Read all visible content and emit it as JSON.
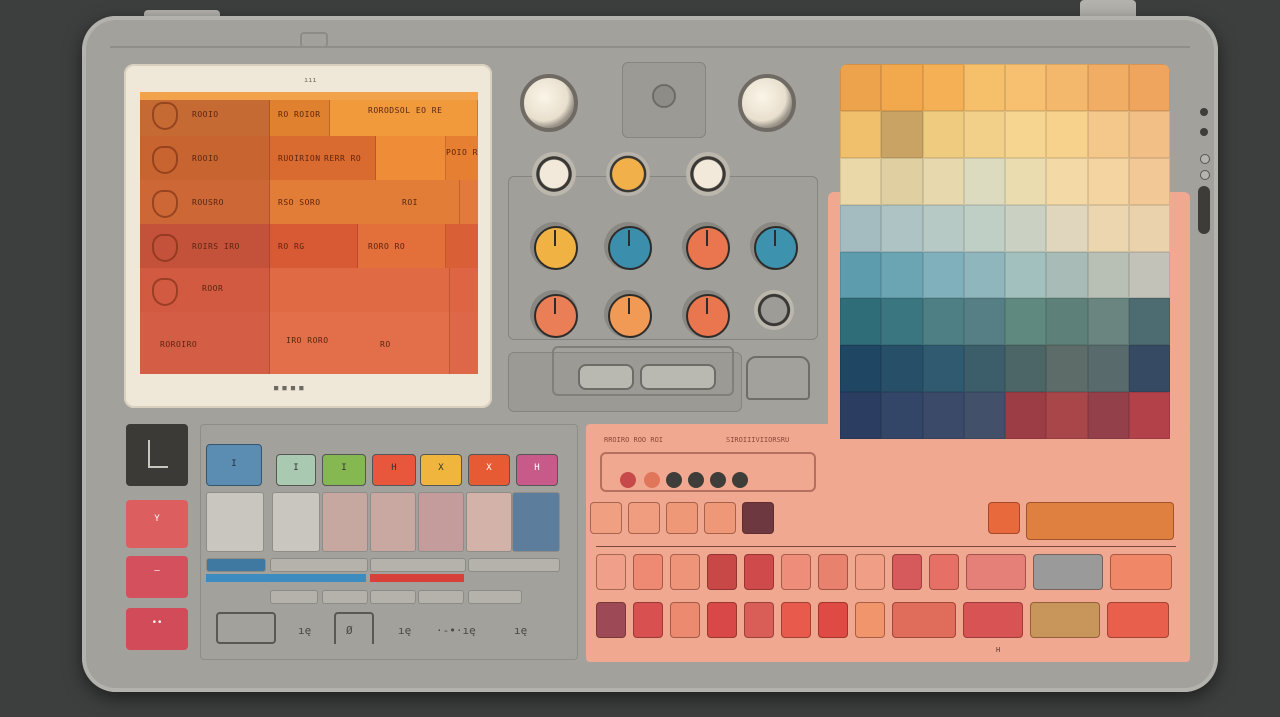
{
  "device": {
    "screen": {
      "top_caption": "ııı",
      "bottom_caption": "■ ■ ■ ■",
      "rows": [
        {
          "name": "ROOIO",
          "field1": "RO ROIOR",
          "field2": "RORODSOL EO RE"
        },
        {
          "name": "ROOIO",
          "field1": "RUOIRION",
          "field2": "RERR RO",
          "field3": "POIO RIOO"
        },
        {
          "name": "ROUSRO",
          "field1": "RSO SORO",
          "field2": "ROI"
        },
        {
          "name": "ROIRS IRO",
          "field1": "RO RG",
          "field2": "RORO RO"
        },
        {
          "name": "ROOR"
        },
        {
          "name": "ROROIRO",
          "field1": "IRO RORO",
          "field2": "RO"
        }
      ]
    },
    "pink_panel": {
      "label_left": "RROIRO ROO  ROI",
      "label_right": "SIROIIIVIIORSRU",
      "footer": "H"
    },
    "left_keys": [
      {
        "label": "Y"
      },
      {
        "label": "—"
      },
      {
        "label": "••"
      }
    ],
    "top_pads": [
      "I",
      "I",
      "I",
      "H",
      "X",
      "H"
    ],
    "bottom_marks": [
      "ıę",
      "Ø",
      "ıę",
      "·-•·ıę",
      "ıę"
    ]
  },
  "colors": {
    "body": "#a2a19b",
    "screen_orange": "#e1703a",
    "accent_pink": "#f0a890",
    "swatches": [
      [
        "#eda24c",
        "#f2a94d",
        "#f5af55",
        "#f6bf6a",
        "#f6c070",
        "#f4b86c",
        "#f2ad64",
        "#f0a55f"
      ],
      [
        "#f0c06c",
        "#c9a364",
        "#efcb80",
        "#f3d08a",
        "#f5d590",
        "#f6d28d",
        "#f4c88a",
        "#f2c086"
      ],
      [
        "#ead8a8",
        "#dfcfa1",
        "#e7d9ad",
        "#dcdbc0",
        "#ebdcb0",
        "#f3d9a6",
        "#f4d4a0",
        "#f1c896"
      ],
      [
        "#a4bcc0",
        "#aec3c3",
        "#b6c9c4",
        "#bfcfc5",
        "#cad1c2",
        "#e0d6bd",
        "#ebd6b0",
        "#ead2ad"
      ],
      [
        "#5c9cac",
        "#6ba5b3",
        "#80b0bc",
        "#8fb6bc",
        "#a2c0bd",
        "#a8bbb6",
        "#b8c0b6",
        "#c2c2b8"
      ],
      [
        "#2f6d79",
        "#3a7680",
        "#4e7f84",
        "#567f85",
        "#5f887e",
        "#5d8078",
        "#6a8580",
        "#4d6c72"
      ],
      [
        "#1f4663",
        "#275068",
        "#2f5a6f",
        "#3c5e6a",
        "#4c6566",
        "#5d6c68",
        "#596a6c",
        "#364b63"
      ],
      [
        "#2b3e62",
        "#344668",
        "#3a4a68",
        "#42506a",
        "#9c3c44",
        "#a8464a",
        "#94404a",
        "#b2414a"
      ],
      [
        "#f0a890",
        "#f0a890",
        "#f0a890",
        "#f0a890",
        "#f0a890",
        "#f0a890",
        "#f0a890",
        "#f0a890"
      ]
    ]
  }
}
